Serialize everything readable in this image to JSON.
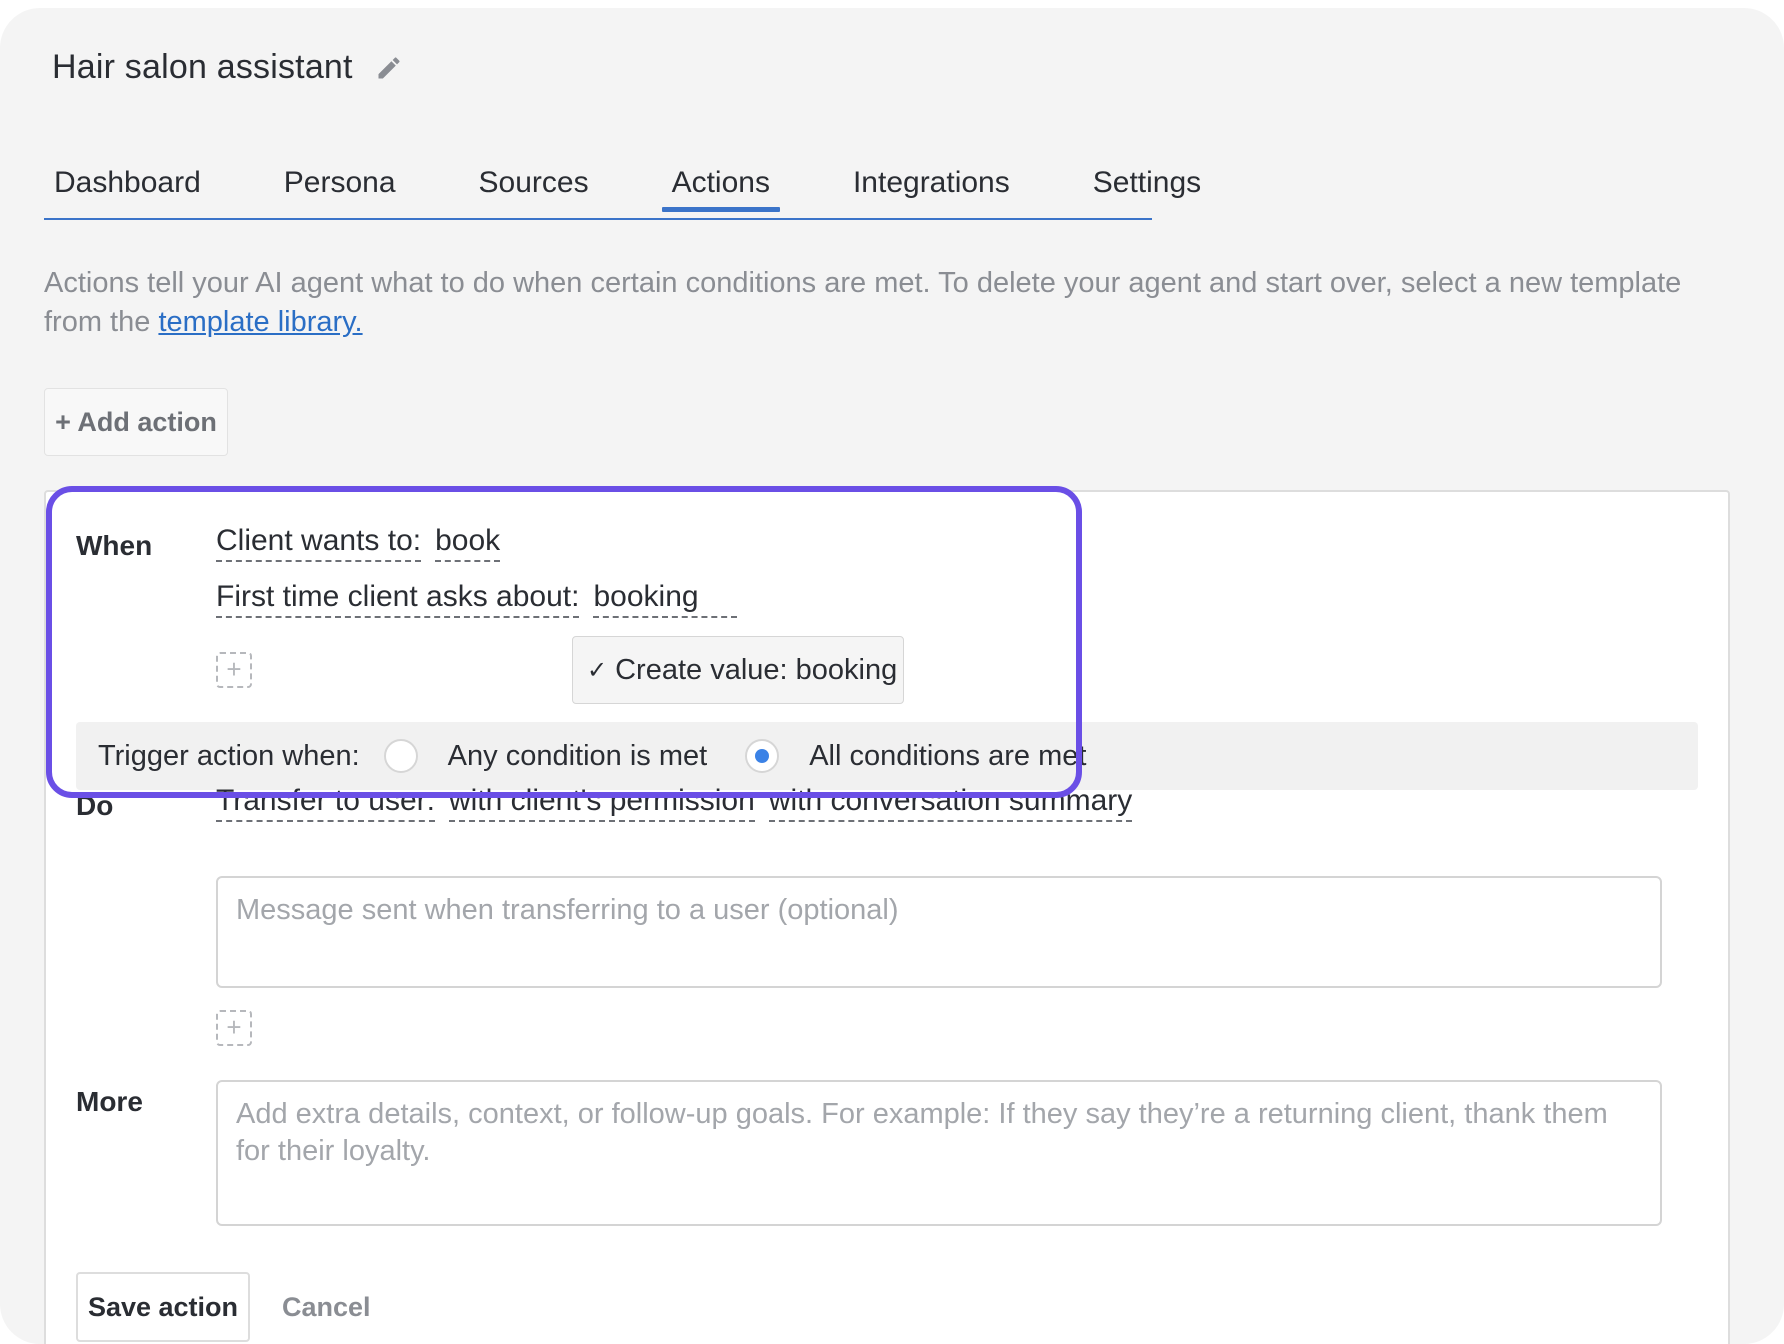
{
  "header": {
    "title": "Hair salon assistant",
    "edit_icon": "pencil-icon"
  },
  "tabs": [
    {
      "label": "Dashboard",
      "active": false
    },
    {
      "label": "Persona",
      "active": false
    },
    {
      "label": "Sources",
      "active": false
    },
    {
      "label": "Actions",
      "active": true
    },
    {
      "label": "Integrations",
      "active": false
    },
    {
      "label": "Settings",
      "active": false
    }
  ],
  "description": {
    "text": "Actions tell your AI agent what to do when certain conditions are met. To delete your agent and start over, select a new template from the",
    "link": "template library."
  },
  "add_action_label": "+ Add action",
  "when": {
    "label": "When",
    "conditions": [
      {
        "name": "Client wants to:",
        "value": "book"
      },
      {
        "name": "First time client asks about:",
        "value": "booking"
      }
    ],
    "dropdown_option": "Create value: booking",
    "trigger": {
      "label": "Trigger action when:",
      "options": [
        {
          "label": "Any condition is met",
          "selected": false
        },
        {
          "label": "All conditions are met",
          "selected": true
        }
      ]
    }
  },
  "do": {
    "label": "Do",
    "action_name": "Transfer to user:",
    "option_1": "with client's permission",
    "option_2": "with conversation summary",
    "message_placeholder": "Message sent when transferring to a user (optional)"
  },
  "more": {
    "label": "More",
    "placeholder": "Add extra details, context, or follow-up goals. For example: If they say they’re a returning client, thank them for their loyalty."
  },
  "buttons": {
    "save": "Save action",
    "cancel": "Cancel"
  },
  "colors": {
    "accent": "#3b74c9",
    "highlight": "#6a4fe6",
    "radio_selected": "#3b82e6"
  }
}
